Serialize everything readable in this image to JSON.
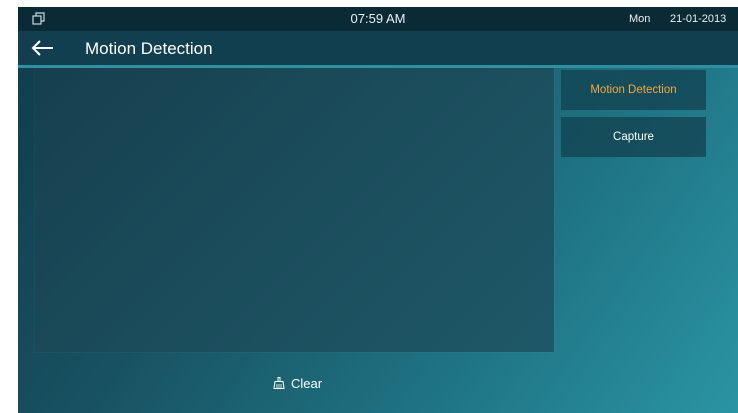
{
  "status_bar": {
    "time": "07:59 AM",
    "day": "Mon",
    "date": "21-01-2013"
  },
  "header": {
    "title": "Motion Detection",
    "back_icon": "arrow-left-icon"
  },
  "side_menu": {
    "items": [
      {
        "label": "Motion Detection",
        "active": true
      },
      {
        "label": "Capture",
        "active": false
      }
    ]
  },
  "footer": {
    "clear_label": "Clear",
    "clear_icon": "broom-icon"
  },
  "colors": {
    "active_item": "#f0a93c",
    "status_bar_bg": "#0a2a36",
    "title_bar_bg": "#123f4f"
  }
}
